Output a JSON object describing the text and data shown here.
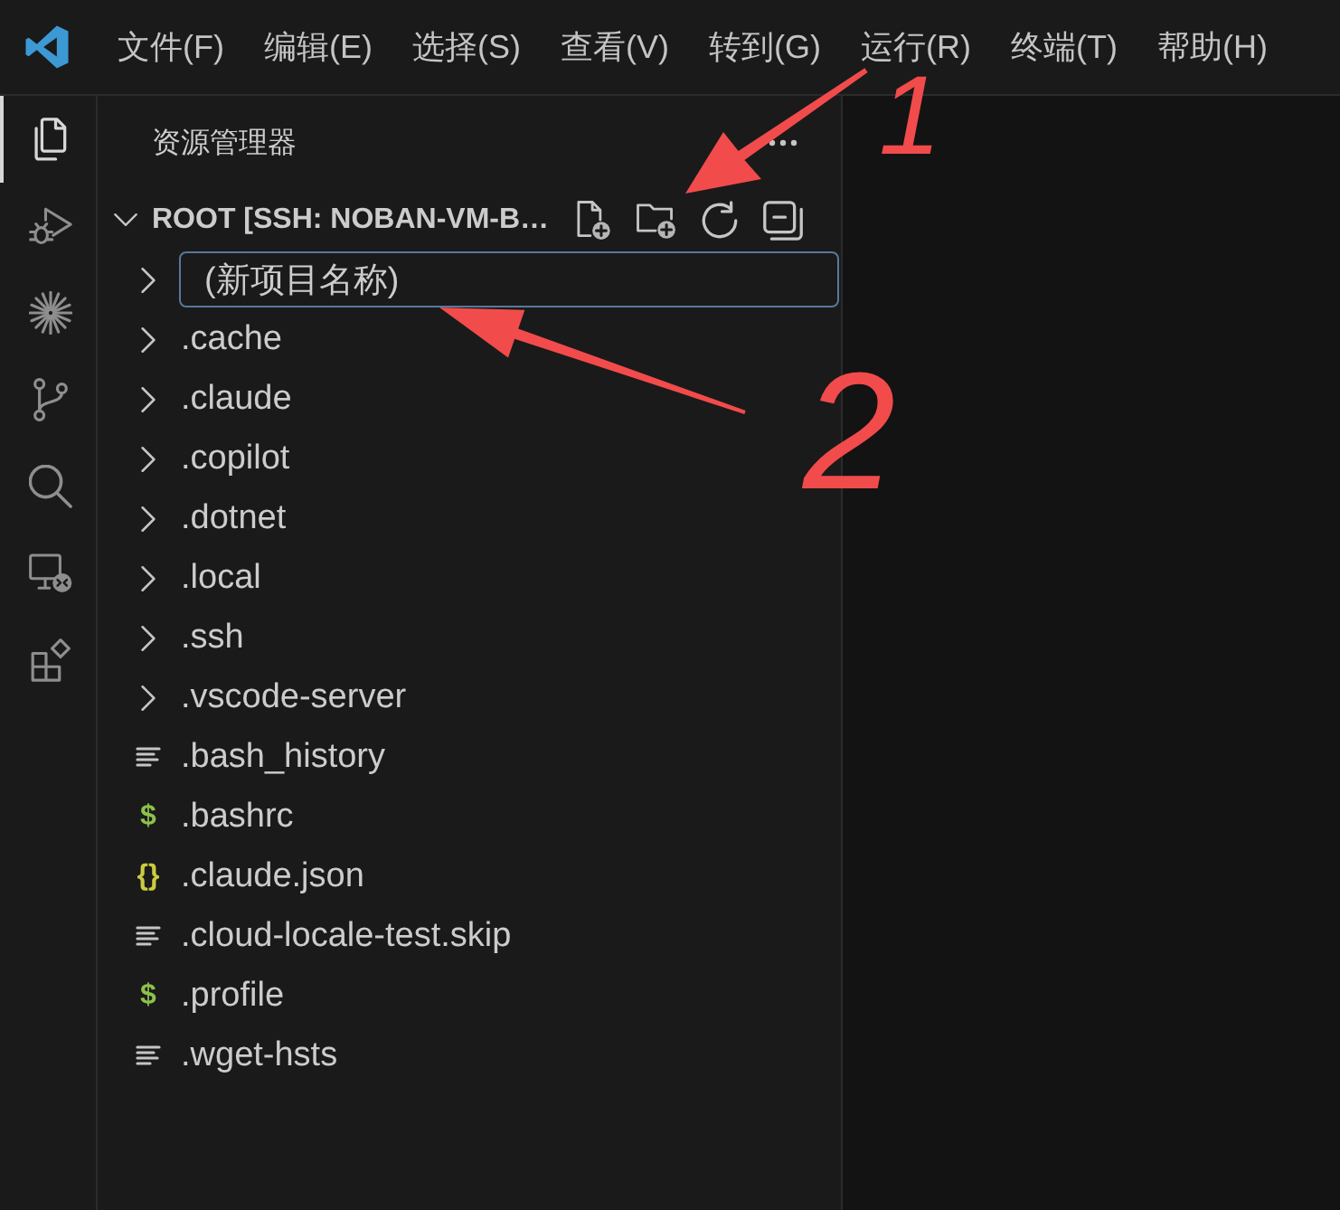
{
  "menu_bar": {
    "items": [
      "文件(F)",
      "编辑(E)",
      "选择(S)",
      "查看(V)",
      "转到(G)",
      "运行(R)",
      "终端(T)",
      "帮助(H)"
    ]
  },
  "activity_bar": {
    "items": [
      {
        "kind": "files",
        "selected": true
      },
      {
        "kind": "debug",
        "selected": false
      },
      {
        "kind": "burst",
        "selected": false
      },
      {
        "kind": "branch",
        "selected": false
      },
      {
        "kind": "search",
        "selected": false
      },
      {
        "kind": "remote",
        "selected": false
      },
      {
        "kind": "extensions",
        "selected": false
      }
    ]
  },
  "explorer": {
    "title": "资源管理器",
    "root": {
      "label": "ROOT [SSH: NOBAN-VM-B…",
      "expanded": true
    },
    "new_item": {
      "value": "(新项目名称)",
      "expanded": false
    },
    "items": [
      {
        "kind": "folder",
        "name": ".cache",
        "expanded": false
      },
      {
        "kind": "folder",
        "name": ".claude",
        "expanded": false
      },
      {
        "kind": "folder",
        "name": ".copilot",
        "expanded": false
      },
      {
        "kind": "folder",
        "name": ".dotnet",
        "expanded": false
      },
      {
        "kind": "folder",
        "name": ".local",
        "expanded": false
      },
      {
        "kind": "folder",
        "name": ".ssh",
        "expanded": false
      },
      {
        "kind": "folder",
        "name": ".vscode-server",
        "expanded": false
      },
      {
        "kind": "text",
        "name": ".bash_history"
      },
      {
        "kind": "shell",
        "icon": "$",
        "name": ".bashrc"
      },
      {
        "kind": "json",
        "icon": "{}",
        "name": ".claude.json"
      },
      {
        "kind": "text",
        "name": ".cloud-locale-test.skip"
      },
      {
        "kind": "shell",
        "icon": "$",
        "name": ".profile"
      },
      {
        "kind": "text",
        "name": ".wget-hsts"
      }
    ]
  },
  "annotations": [
    {
      "label": "1"
    },
    {
      "label": "2"
    }
  ]
}
